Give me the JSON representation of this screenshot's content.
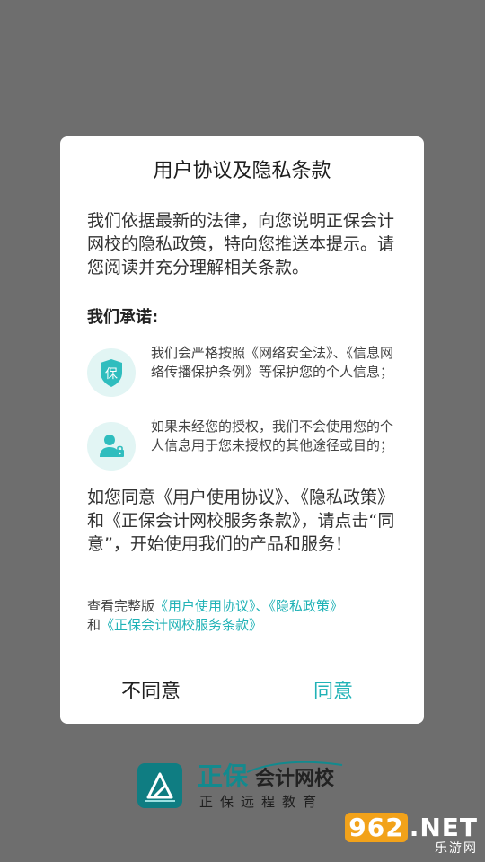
{
  "dialog": {
    "title": "用户协议及隐私条款",
    "intro": "我们依据最新的法律，向您说明正保会计网校的隐私政策，特向您推送本提示。请您阅读并充分理解相关条款。",
    "promise_title": "我们承诺:",
    "promises": [
      {
        "icon": "shield-icon",
        "icon_char": "保",
        "text": "我们会严格按照《网络安全法》、《信息网络传播保护条例》等保护您的个人信息；"
      },
      {
        "icon": "user-lock-icon",
        "text": "如果未经您的授权，我们不会使用您的个人信息用于您未授权的其他途径或目的；"
      }
    ],
    "consent": "如您同意《用户使用协议》、《隐私政策》和《正保会计网校服务条款》，请点击“同意”，开始使用我们的产品和服务！",
    "links": {
      "prefix": "查看完整版",
      "user_agreement": "《用户使用协议》",
      "separator": "、",
      "privacy_policy": "《隐私政策》",
      "and": "和",
      "service_terms": "《正保会计网校服务条款》"
    },
    "buttons": {
      "disagree": "不同意",
      "agree": "同意"
    }
  },
  "brand": {
    "name": "正保",
    "product": "会计网校",
    "subtitle": "正保远程教育"
  },
  "watermark": {
    "number": "962",
    "suffix": ".NET",
    "subtitle": "乐游网"
  },
  "colors": {
    "accent": "#20b2b6",
    "overlay": "#6e6e6e",
    "brand": "#138a8e"
  }
}
